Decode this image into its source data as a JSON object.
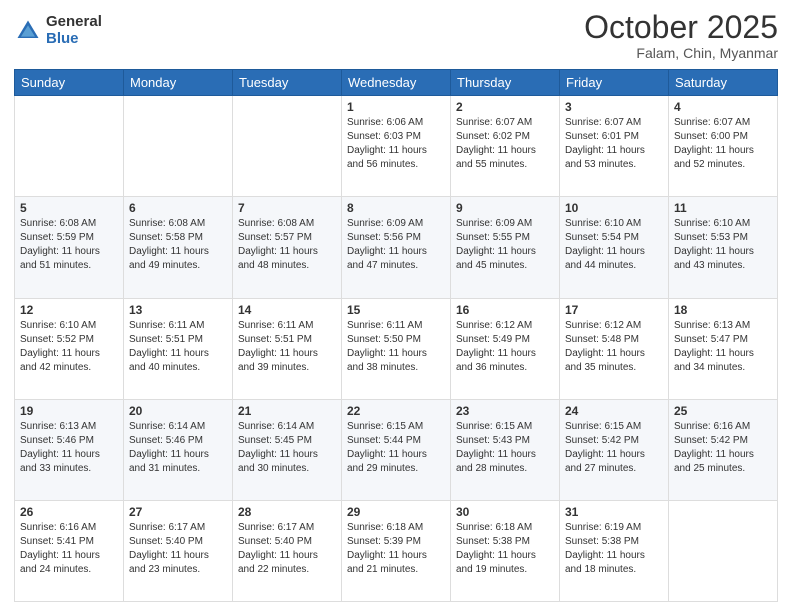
{
  "header": {
    "logo": {
      "general": "General",
      "blue": "Blue"
    },
    "title": "October 2025",
    "location": "Falam, Chin, Myanmar"
  },
  "weekdays": [
    "Sunday",
    "Monday",
    "Tuesday",
    "Wednesday",
    "Thursday",
    "Friday",
    "Saturday"
  ],
  "weeks": [
    [
      {
        "day": "",
        "info": ""
      },
      {
        "day": "",
        "info": ""
      },
      {
        "day": "",
        "info": ""
      },
      {
        "day": "1",
        "info": "Sunrise: 6:06 AM\nSunset: 6:03 PM\nDaylight: 11 hours\nand 56 minutes."
      },
      {
        "day": "2",
        "info": "Sunrise: 6:07 AM\nSunset: 6:02 PM\nDaylight: 11 hours\nand 55 minutes."
      },
      {
        "day": "3",
        "info": "Sunrise: 6:07 AM\nSunset: 6:01 PM\nDaylight: 11 hours\nand 53 minutes."
      },
      {
        "day": "4",
        "info": "Sunrise: 6:07 AM\nSunset: 6:00 PM\nDaylight: 11 hours\nand 52 minutes."
      }
    ],
    [
      {
        "day": "5",
        "info": "Sunrise: 6:08 AM\nSunset: 5:59 PM\nDaylight: 11 hours\nand 51 minutes."
      },
      {
        "day": "6",
        "info": "Sunrise: 6:08 AM\nSunset: 5:58 PM\nDaylight: 11 hours\nand 49 minutes."
      },
      {
        "day": "7",
        "info": "Sunrise: 6:08 AM\nSunset: 5:57 PM\nDaylight: 11 hours\nand 48 minutes."
      },
      {
        "day": "8",
        "info": "Sunrise: 6:09 AM\nSunset: 5:56 PM\nDaylight: 11 hours\nand 47 minutes."
      },
      {
        "day": "9",
        "info": "Sunrise: 6:09 AM\nSunset: 5:55 PM\nDaylight: 11 hours\nand 45 minutes."
      },
      {
        "day": "10",
        "info": "Sunrise: 6:10 AM\nSunset: 5:54 PM\nDaylight: 11 hours\nand 44 minutes."
      },
      {
        "day": "11",
        "info": "Sunrise: 6:10 AM\nSunset: 5:53 PM\nDaylight: 11 hours\nand 43 minutes."
      }
    ],
    [
      {
        "day": "12",
        "info": "Sunrise: 6:10 AM\nSunset: 5:52 PM\nDaylight: 11 hours\nand 42 minutes."
      },
      {
        "day": "13",
        "info": "Sunrise: 6:11 AM\nSunset: 5:51 PM\nDaylight: 11 hours\nand 40 minutes."
      },
      {
        "day": "14",
        "info": "Sunrise: 6:11 AM\nSunset: 5:51 PM\nDaylight: 11 hours\nand 39 minutes."
      },
      {
        "day": "15",
        "info": "Sunrise: 6:11 AM\nSunset: 5:50 PM\nDaylight: 11 hours\nand 38 minutes."
      },
      {
        "day": "16",
        "info": "Sunrise: 6:12 AM\nSunset: 5:49 PM\nDaylight: 11 hours\nand 36 minutes."
      },
      {
        "day": "17",
        "info": "Sunrise: 6:12 AM\nSunset: 5:48 PM\nDaylight: 11 hours\nand 35 minutes."
      },
      {
        "day": "18",
        "info": "Sunrise: 6:13 AM\nSunset: 5:47 PM\nDaylight: 11 hours\nand 34 minutes."
      }
    ],
    [
      {
        "day": "19",
        "info": "Sunrise: 6:13 AM\nSunset: 5:46 PM\nDaylight: 11 hours\nand 33 minutes."
      },
      {
        "day": "20",
        "info": "Sunrise: 6:14 AM\nSunset: 5:46 PM\nDaylight: 11 hours\nand 31 minutes."
      },
      {
        "day": "21",
        "info": "Sunrise: 6:14 AM\nSunset: 5:45 PM\nDaylight: 11 hours\nand 30 minutes."
      },
      {
        "day": "22",
        "info": "Sunrise: 6:15 AM\nSunset: 5:44 PM\nDaylight: 11 hours\nand 29 minutes."
      },
      {
        "day": "23",
        "info": "Sunrise: 6:15 AM\nSunset: 5:43 PM\nDaylight: 11 hours\nand 28 minutes."
      },
      {
        "day": "24",
        "info": "Sunrise: 6:15 AM\nSunset: 5:42 PM\nDaylight: 11 hours\nand 27 minutes."
      },
      {
        "day": "25",
        "info": "Sunrise: 6:16 AM\nSunset: 5:42 PM\nDaylight: 11 hours\nand 25 minutes."
      }
    ],
    [
      {
        "day": "26",
        "info": "Sunrise: 6:16 AM\nSunset: 5:41 PM\nDaylight: 11 hours\nand 24 minutes."
      },
      {
        "day": "27",
        "info": "Sunrise: 6:17 AM\nSunset: 5:40 PM\nDaylight: 11 hours\nand 23 minutes."
      },
      {
        "day": "28",
        "info": "Sunrise: 6:17 AM\nSunset: 5:40 PM\nDaylight: 11 hours\nand 22 minutes."
      },
      {
        "day": "29",
        "info": "Sunrise: 6:18 AM\nSunset: 5:39 PM\nDaylight: 11 hours\nand 21 minutes."
      },
      {
        "day": "30",
        "info": "Sunrise: 6:18 AM\nSunset: 5:38 PM\nDaylight: 11 hours\nand 19 minutes."
      },
      {
        "day": "31",
        "info": "Sunrise: 6:19 AM\nSunset: 5:38 PM\nDaylight: 11 hours\nand 18 minutes."
      },
      {
        "day": "",
        "info": ""
      }
    ]
  ]
}
